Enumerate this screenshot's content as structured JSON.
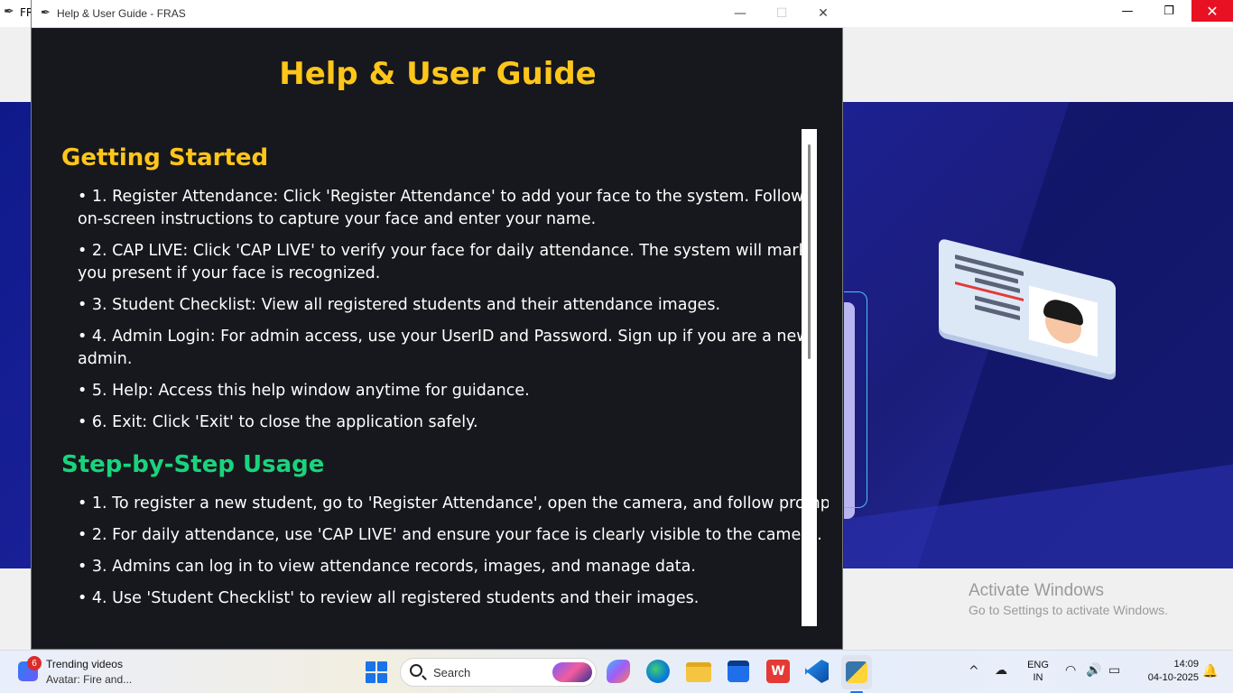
{
  "background_window": {
    "title": "FR",
    "controls": {
      "minimize": "—",
      "maximize": "❐",
      "close": "✕"
    }
  },
  "help_window": {
    "window_title": "Help & User Guide - FRAS",
    "controls": {
      "minimize": "—",
      "maximize": "☐",
      "close": "✕"
    },
    "heading": "Help & User Guide",
    "sections": [
      {
        "title": "Getting Started",
        "items": [
          "• 1. Register Attendance: Click 'Register Attendance' to add your face to the system. Follow on-screen instructions to capture your face and enter your name.",
          "• 2. CAP LIVE: Click 'CAP LIVE' to verify your face for daily attendance. The system will mark you present if your face is recognized.",
          "• 3. Student Checklist: View all registered students and their attendance images.",
          "• 4. Admin Login: For admin access, use your UserID and Password. Sign up if you are a new admin.",
          "• 5. Help: Access this help window anytime for guidance.",
          "• 6. Exit: Click 'Exit' to close the application safely."
        ]
      },
      {
        "title": "Step-by-Step Usage",
        "items": [
          "• 1. To register a new student, go to 'Register Attendance', open the camera, and follow prompts.",
          "• 2. For daily attendance, use 'CAP LIVE' and ensure your face is clearly visible to the camera.",
          "• 3. Admins can log in to view attendance records, images, and manage data.",
          "• 4. Use 'Student Checklist' to review all registered students and their images."
        ]
      }
    ]
  },
  "watermark": {
    "title": "Activate Windows",
    "subtitle": "Go to Settings to activate Windows."
  },
  "taskbar": {
    "widget": {
      "badge": "6",
      "title": "Trending videos",
      "subtitle": "Avatar: Fire and..."
    },
    "search_placeholder": "Search",
    "language": {
      "line1": "ENG",
      "line2": "IN"
    },
    "time": "14:09",
    "date": "04-10-2025"
  },
  "colors": {
    "heading_yellow": "#ffc61a",
    "section_green": "#19d47c",
    "window_bg": "#17181d"
  }
}
